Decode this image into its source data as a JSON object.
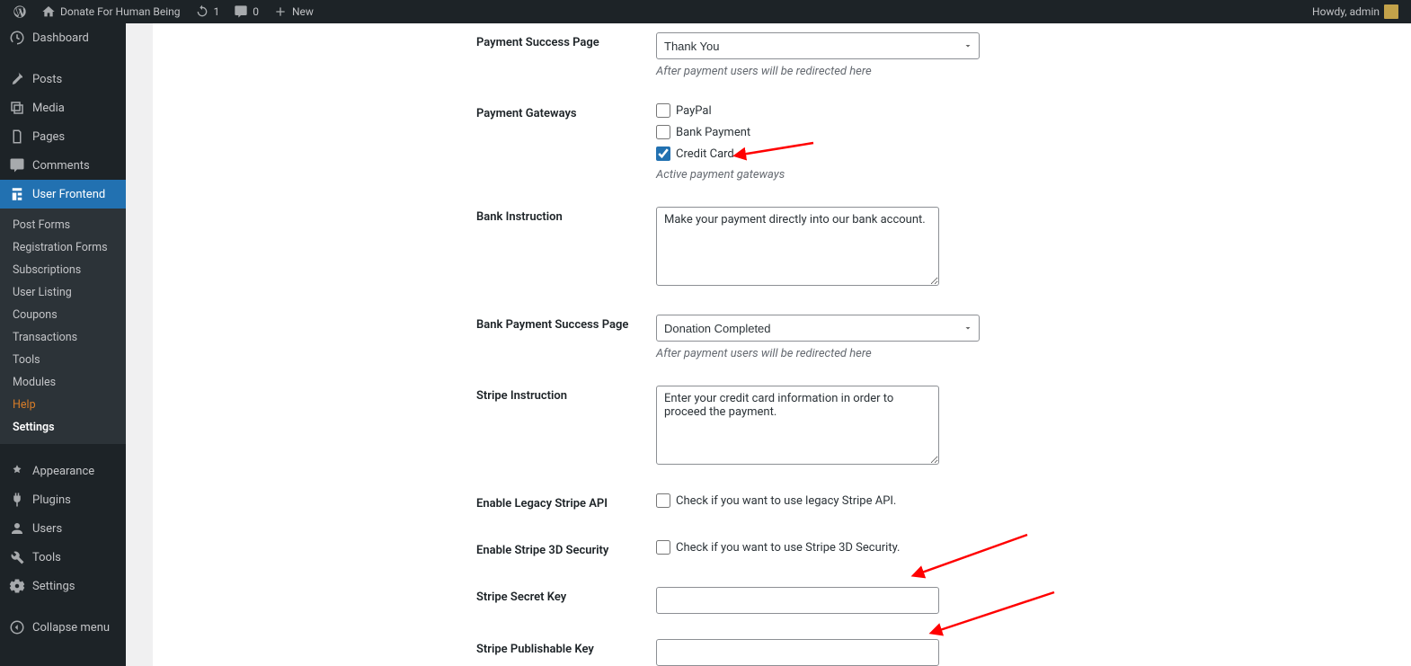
{
  "adminbar": {
    "site_name": "Donate For Human Being",
    "updates": "1",
    "comments": "0",
    "new": "New",
    "howdy": "Howdy, admin"
  },
  "sidebar": {
    "dashboard": "Dashboard",
    "posts": "Posts",
    "media": "Media",
    "pages": "Pages",
    "comments": "Comments",
    "user_frontend": "User Frontend",
    "appearance": "Appearance",
    "plugins": "Plugins",
    "users": "Users",
    "tools": "Tools",
    "settings": "Settings",
    "collapse": "Collapse menu"
  },
  "submenu": {
    "post_forms": "Post Forms",
    "registration_forms": "Registration Forms",
    "subscriptions": "Subscriptions",
    "user_listing": "User Listing",
    "coupons": "Coupons",
    "transactions": "Transactions",
    "tools": "Tools",
    "modules": "Modules",
    "help": "Help",
    "settings": "Settings"
  },
  "form": {
    "payment_success_page": {
      "label": "Payment Success Page",
      "value": "Thank You",
      "help": "After payment users will be redirected here"
    },
    "payment_gateways": {
      "label": "Payment Gateways",
      "paypal": "PayPal",
      "bank": "Bank Payment",
      "credit": "Credit Card",
      "help": "Active payment gateways"
    },
    "bank_instruction": {
      "label": "Bank Instruction",
      "value": "Make your payment directly into our bank account."
    },
    "bank_success_page": {
      "label": "Bank Payment Success Page",
      "value": "Donation Completed",
      "help": "After payment users will be redirected here"
    },
    "stripe_instruction": {
      "label": "Stripe Instruction",
      "value": "Enter your credit card information in order to proceed the payment."
    },
    "legacy_api": {
      "label": "Enable Legacy Stripe API",
      "check_label": "Check if you want to use legacy Stripe API."
    },
    "stripe_3d": {
      "label": "Enable Stripe 3D Security",
      "check_label": "Check if you want to use Stripe 3D Security."
    },
    "secret_key": {
      "label": "Stripe Secret Key"
    },
    "pub_key": {
      "label": "Stripe Publishable Key"
    }
  }
}
